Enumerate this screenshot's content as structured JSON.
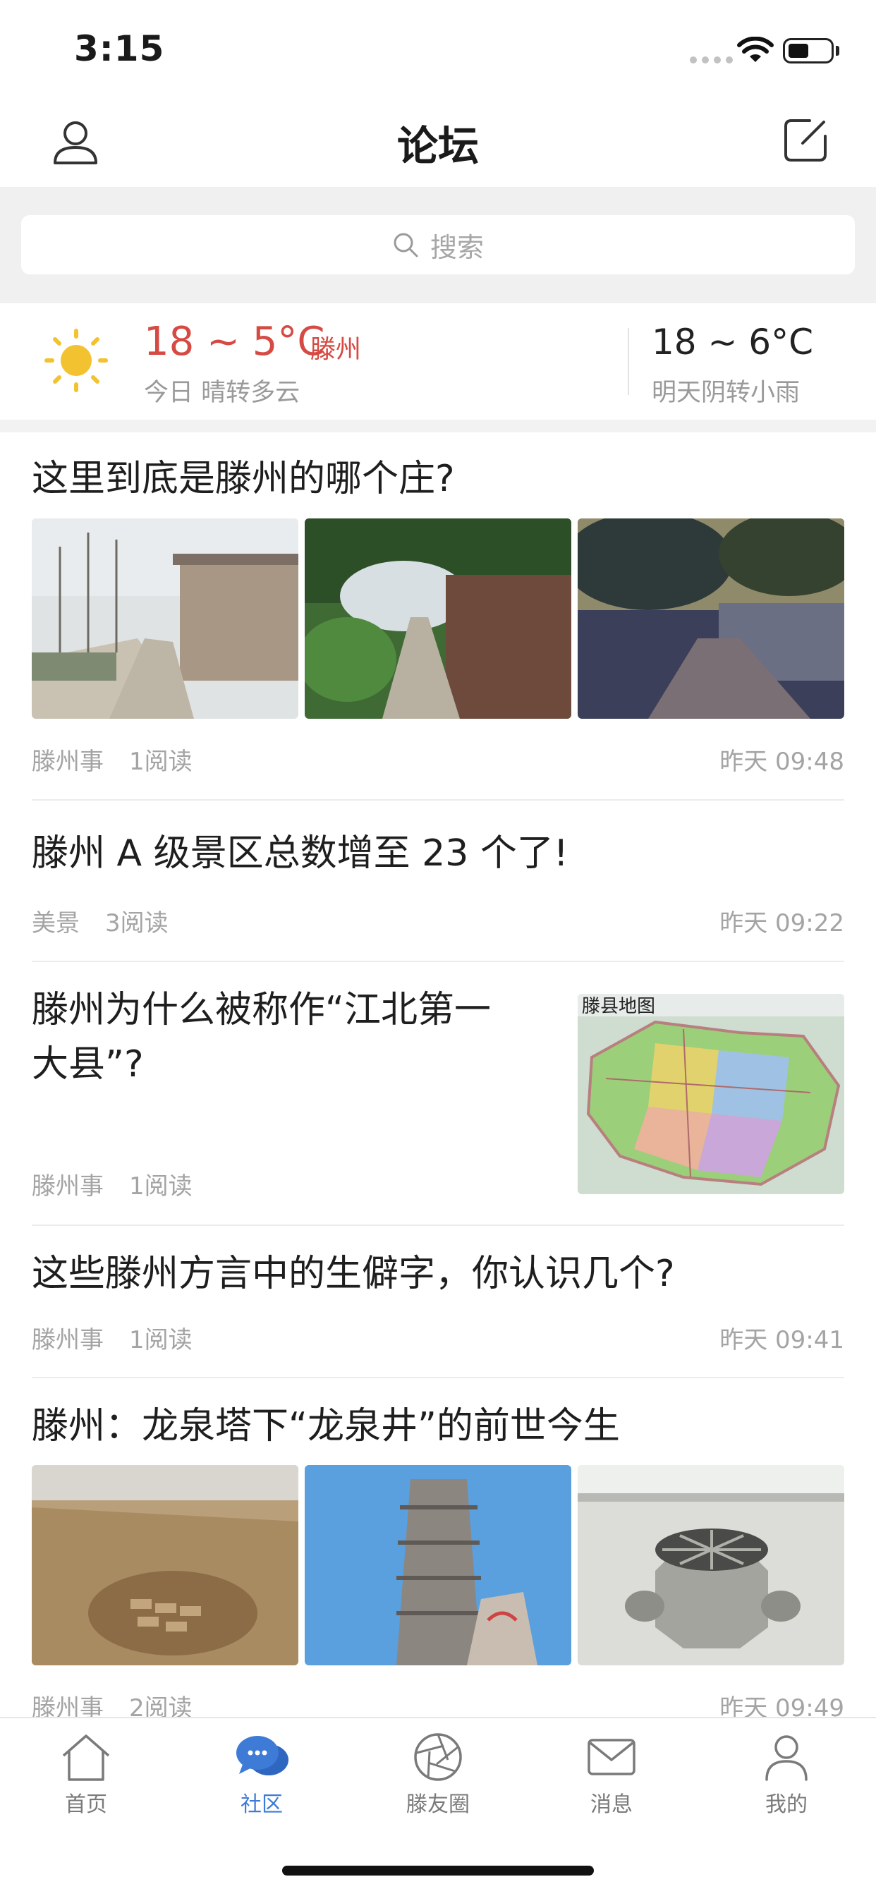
{
  "status_bar": {
    "time": "3:15"
  },
  "nav": {
    "title": "论坛"
  },
  "search": {
    "placeholder": "搜索"
  },
  "weather": {
    "today_temp": "18 ~ 5°C",
    "city": "滕州",
    "today_desc": "今日 晴转多云",
    "tomorrow_temp": "18 ~ 6°C",
    "tomorrow_desc": "明天阴转小雨"
  },
  "posts": [
    {
      "title": "这里到底是滕州的哪个庄?",
      "category": "滕州事",
      "reads": "1阅读",
      "time": "昨天 09:48"
    },
    {
      "title": "滕州 A 级景区总数增至 23 个了!",
      "category": "美景",
      "reads": "3阅读",
      "time": "昨天 09:22"
    },
    {
      "title_line1": "滕州为什么被称作“江北第一",
      "title_line2": "大县”?",
      "category": "滕州事",
      "reads": "1阅读",
      "map_caption": "滕县地图"
    },
    {
      "title": "这些滕州方言中的生僻字，你认识几个?",
      "category": "滕州事",
      "reads": "1阅读",
      "time": "昨天 09:41"
    },
    {
      "title": "滕州：龙泉塔下“龙泉井”的前世今生",
      "category": "滕州事",
      "reads": "2阅读",
      "time": "昨天 09:49"
    }
  ],
  "tabs": [
    {
      "label": "首页",
      "icon": "home-icon"
    },
    {
      "label": "社区",
      "icon": "chat-bubble-icon"
    },
    {
      "label": "滕友圈",
      "icon": "aperture-icon"
    },
    {
      "label": "消息",
      "icon": "mail-icon"
    },
    {
      "label": "我的",
      "icon": "person-icon"
    }
  ],
  "colors": {
    "accent": "#3d7bd6",
    "temp_red": "#d54b44",
    "sun": "#f2c230"
  }
}
